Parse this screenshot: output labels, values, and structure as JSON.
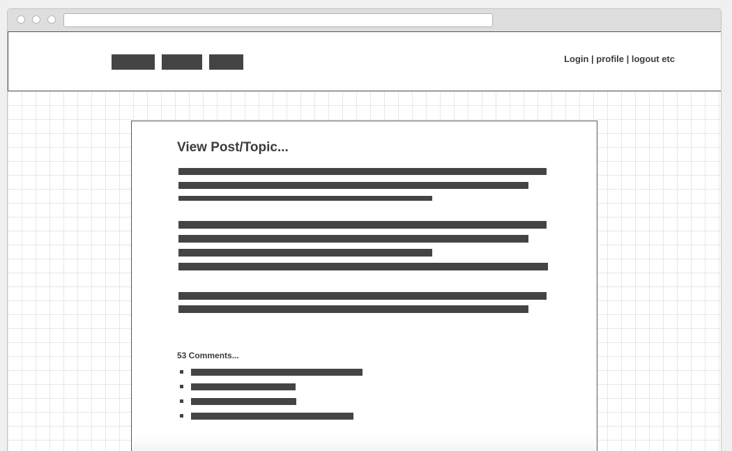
{
  "browser": {
    "url": ""
  },
  "header": {
    "nav_items": [
      "",
      "",
      ""
    ],
    "user_links": "Login | profile | logout etc"
  },
  "post": {
    "title": "View Post/Topic..."
  },
  "comments": {
    "count_label": "53 Comments..."
  },
  "colors": {
    "placeholder_block": "#444444",
    "grid_line": "#e7e7e7",
    "border": "#555555"
  }
}
